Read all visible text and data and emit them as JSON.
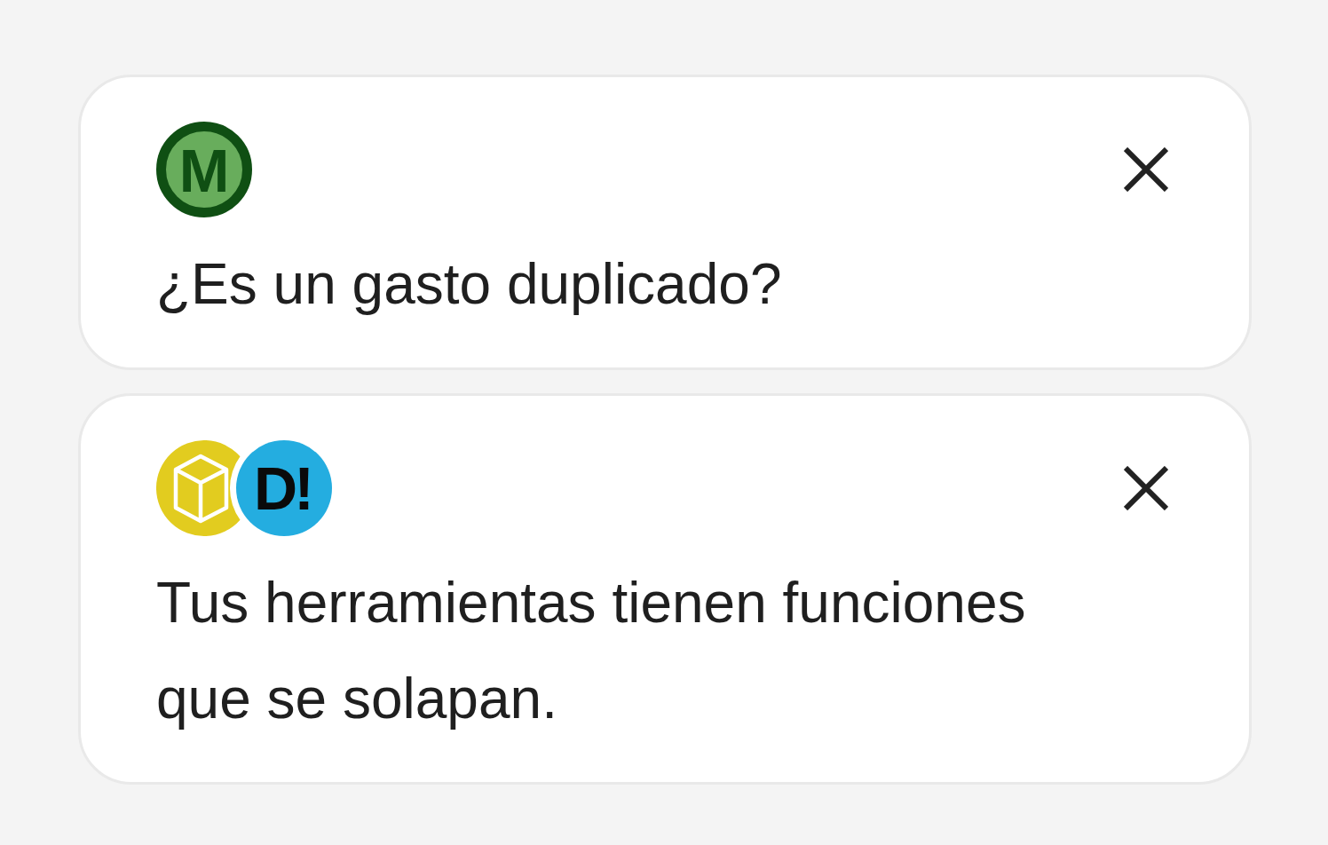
{
  "notifications": [
    {
      "logos": [
        {
          "kind": "ring-monogram",
          "text": "M"
        }
      ],
      "message": "¿Es un gasto duplicado?"
    },
    {
      "logos": [
        {
          "kind": "cube"
        },
        {
          "kind": "disc-monogram",
          "text": "D!"
        }
      ],
      "message": "Tus herramientas tienen funciones que se solapan."
    }
  ]
}
